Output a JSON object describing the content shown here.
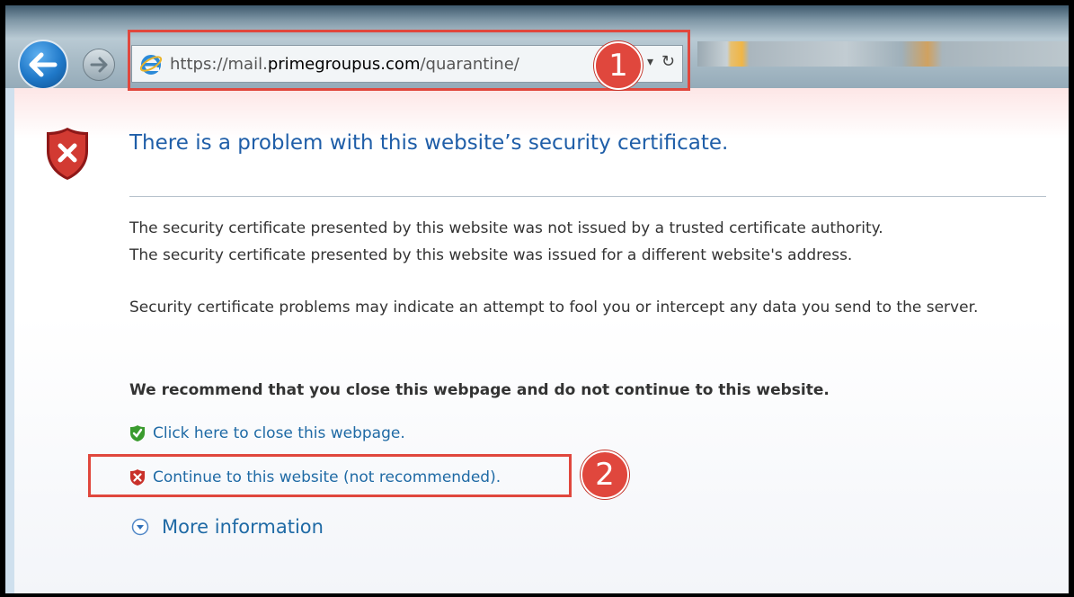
{
  "browser": {
    "address_prefix": "https://mail.",
    "address_domain": "primegroupus.com",
    "address_path": "/quarantine/",
    "dropdown_glyph": "▾",
    "refresh_glyph": "↻"
  },
  "annotations": {
    "badge_1": "1",
    "badge_2": "2",
    "color": "#e0473d"
  },
  "page": {
    "title": "There is a problem with this website’s security certificate.",
    "line_1": "The security certificate presented by this website was not issued by a trusted certificate authority.",
    "line_2": "The security certificate presented by this website was issued for a different website's address.",
    "warning": "Security certificate problems may indicate an attempt to fool you or intercept any data you send to the server.",
    "recommendation": "We recommend that you close this webpage and do not continue to this website.",
    "close_link": "Click here to close this webpage.",
    "continue_link": "Continue to this website (not recommended).",
    "more_info": "More information"
  },
  "icons": {
    "big_shield": "error-shield-icon",
    "close_shield": "green-check-shield-icon",
    "continue_shield": "red-x-shield-icon",
    "more_info": "chevron-down-circle-icon"
  }
}
